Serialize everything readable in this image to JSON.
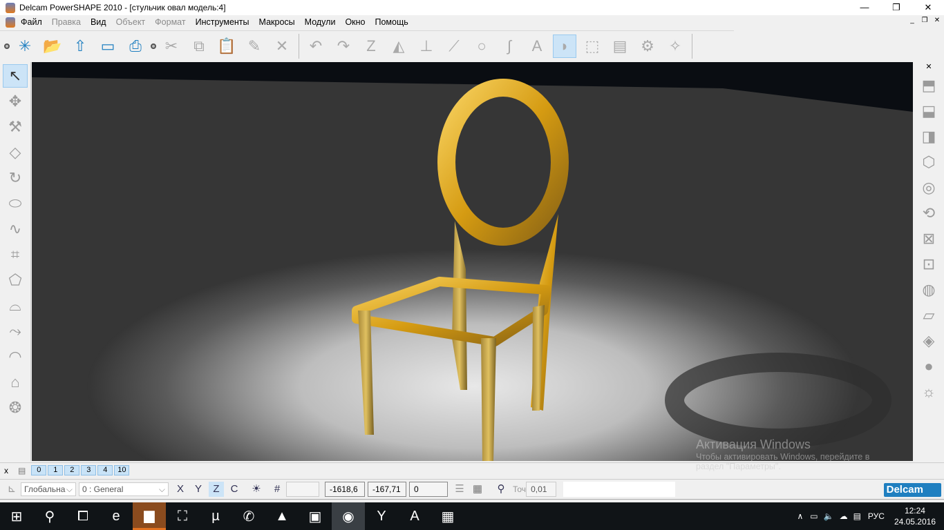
{
  "window": {
    "title": "Delcam PowerSHAPE 2010 - [стульчик овал модель:4]",
    "minimize": "—",
    "maximize": "❐",
    "close": "✕"
  },
  "menu": [
    {
      "label": "Файл",
      "enabled": true
    },
    {
      "label": "Правка",
      "enabled": false
    },
    {
      "label": "Вид",
      "enabled": true
    },
    {
      "label": "Объект",
      "enabled": false
    },
    {
      "label": "Формат",
      "enabled": false
    },
    {
      "label": "Инструменты",
      "enabled": true
    },
    {
      "label": "Макросы",
      "enabled": true
    },
    {
      "label": "Модули",
      "enabled": true
    },
    {
      "label": "Окно",
      "enabled": true
    },
    {
      "label": "Помощь",
      "enabled": true
    }
  ],
  "mdi_controls": {
    "minimize": "_",
    "restore": "❐",
    "close": "✕"
  },
  "toolbar": [
    {
      "icon": "new-file-icon",
      "g": "✳"
    },
    {
      "icon": "open-folder-icon",
      "g": "📂"
    },
    {
      "icon": "import-icon",
      "g": "⇧"
    },
    {
      "icon": "save-icon",
      "g": "▭"
    },
    {
      "icon": "print-icon",
      "g": "⎙"
    },
    {
      "icon": "cut-icon",
      "g": "✂"
    },
    {
      "icon": "copy-icon",
      "g": "⧉"
    },
    {
      "icon": "paste-icon",
      "g": "📋"
    },
    {
      "icon": "edit-icon",
      "g": "✎"
    },
    {
      "icon": "delete-icon",
      "g": "✕"
    },
    {
      "icon": "undo-icon",
      "g": "↶"
    },
    {
      "icon": "redo-icon",
      "g": "↷"
    },
    {
      "icon": "wireframe-edit-icon",
      "g": "Z"
    },
    {
      "icon": "solid-tools-icon",
      "g": "◭"
    },
    {
      "icon": "workplane-icon",
      "g": "⊥"
    },
    {
      "icon": "line-icon",
      "g": "⟋"
    },
    {
      "icon": "arc-icon",
      "g": "○"
    },
    {
      "icon": "curve-icon",
      "g": "∫"
    },
    {
      "icon": "text-icon",
      "g": "A"
    },
    {
      "icon": "surface-icon",
      "g": "◗"
    },
    {
      "icon": "solid-icon",
      "g": "⬚"
    },
    {
      "icon": "electrode-icon",
      "g": "▤"
    },
    {
      "icon": "assembly-icon",
      "g": "⚙"
    },
    {
      "icon": "wizard-icon",
      "g": "✧"
    }
  ],
  "left_toolbar": [
    {
      "icon": "select-icon",
      "g": "↖"
    },
    {
      "icon": "transform-icon",
      "g": "✥"
    },
    {
      "icon": "tools-icon",
      "g": "⚒"
    },
    {
      "icon": "diamond-icon",
      "g": "◇"
    },
    {
      "icon": "rotate-surface-icon",
      "g": "↻"
    },
    {
      "icon": "extrude-icon",
      "g": "⬭"
    },
    {
      "icon": "sweep-icon",
      "g": "∿"
    },
    {
      "icon": "network-icon",
      "g": "⌗"
    },
    {
      "icon": "loft-icon",
      "g": "⬠"
    },
    {
      "icon": "drive-curve-icon",
      "g": "⌓"
    },
    {
      "icon": "blend-icon",
      "g": "⤳"
    },
    {
      "icon": "fillet-icon",
      "g": "◠"
    },
    {
      "icon": "flange-icon",
      "g": "⌂"
    },
    {
      "icon": "morph-icon",
      "g": "❂"
    }
  ],
  "right_toolbar": [
    {
      "icon": "view-top-icon",
      "g": "⬒"
    },
    {
      "icon": "view-front-icon",
      "g": "⬓"
    },
    {
      "icon": "view-side-icon",
      "g": "◨"
    },
    {
      "icon": "view-iso-icon",
      "g": "⬡"
    },
    {
      "icon": "view-camera-icon",
      "g": "◎"
    },
    {
      "icon": "zoom-rotate-icon",
      "g": "⟲"
    },
    {
      "icon": "zoom-fit-icon",
      "g": "⊠"
    },
    {
      "icon": "zoom-box-icon",
      "g": "⊡"
    },
    {
      "icon": "shade-wireframe-icon",
      "g": "◍"
    },
    {
      "icon": "shade-solid-icon",
      "g": "▱"
    },
    {
      "icon": "shade-diamond-icon",
      "g": "◈"
    },
    {
      "icon": "shade-sphere-icon",
      "g": "●"
    },
    {
      "icon": "lighting-icon",
      "g": "☼"
    }
  ],
  "levels": {
    "close": "x",
    "items": [
      "0",
      "1",
      "2",
      "3",
      "4",
      "10"
    ]
  },
  "status": {
    "workplane": "Глобальна",
    "level": "0  : General",
    "x": "-1618,6",
    "y": "-167,71",
    "z": "0",
    "tolerance_label": "Точ",
    "tolerance": "0,01",
    "brand": "Delcam"
  },
  "activation": {
    "title": "Активация Windows",
    "line1": "Чтобы активировать Windows, перейдите в",
    "line2": "раздел \"Параметры\"."
  },
  "taskbar": {
    "apps": [
      {
        "icon": "start-icon",
        "g": "⊞"
      },
      {
        "icon": "search-icon",
        "g": "⚲"
      },
      {
        "icon": "task-view-icon",
        "g": "⧠"
      },
      {
        "icon": "edge-icon",
        "g": "e"
      },
      {
        "icon": "explorer-icon",
        "g": "▆"
      },
      {
        "icon": "store-icon",
        "g": "⛶"
      },
      {
        "icon": "utorrent-icon",
        "g": "µ"
      },
      {
        "icon": "viber-icon",
        "g": "✆"
      },
      {
        "icon": "photos-icon",
        "g": "▲"
      },
      {
        "icon": "monitor-icon",
        "g": "▣"
      },
      {
        "icon": "powershape-icon",
        "g": "◉"
      },
      {
        "icon": "yandex-icon",
        "g": "Y"
      },
      {
        "icon": "artcam-icon",
        "g": "A"
      },
      {
        "icon": "winrar-icon",
        "g": "▦"
      }
    ],
    "lang": "РУС",
    "time": "12:24",
    "date": "24.05.2016"
  },
  "colors": {
    "gold": "#d9a520",
    "viewport_bg": "#0a0d12",
    "accent": "#1f7fc0"
  }
}
